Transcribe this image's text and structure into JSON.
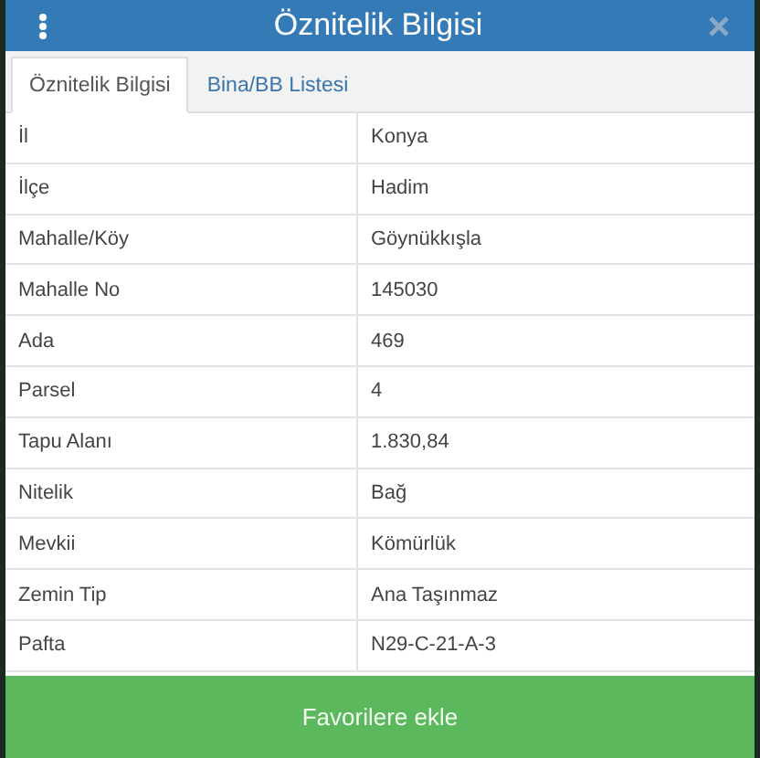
{
  "header": {
    "title": "Öznitelik Bilgisi"
  },
  "tabs": [
    {
      "label": "Öznitelik Bilgisi",
      "selected": true
    },
    {
      "label": "Bina/BB Listesi",
      "selected": false
    }
  ],
  "rows": [
    {
      "label": "İl",
      "value": "Konya"
    },
    {
      "label": "İlçe",
      "value": "Hadim"
    },
    {
      "label": "Mahalle/Köy",
      "value": "Göynükkışla"
    },
    {
      "label": "Mahalle No",
      "value": "145030"
    },
    {
      "label": "Ada",
      "value": "469"
    },
    {
      "label": "Parsel",
      "value": "4"
    },
    {
      "label": "Tapu Alanı",
      "value": "1.830,84"
    },
    {
      "label": "Nitelik",
      "value": "Bağ"
    },
    {
      "label": "Mevkii",
      "value": "Kömürlük"
    },
    {
      "label": "Zemin Tip",
      "value": "Ana Taşınmaz"
    },
    {
      "label": "Pafta",
      "value": "N29-C-21-A-3"
    }
  ],
  "button": {
    "label": "Favorilere ekle"
  }
}
